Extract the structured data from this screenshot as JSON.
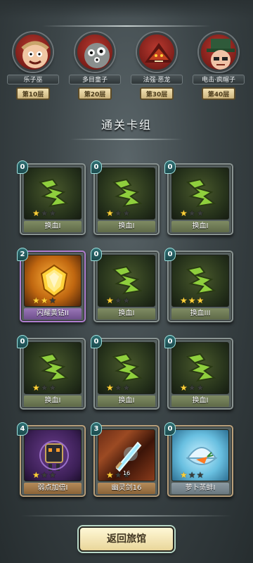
{
  "bosses": [
    {
      "name": "乐子巫",
      "floor": "第10层"
    },
    {
      "name": "多目童子",
      "floor": "第20层"
    },
    {
      "name": "法强·恶龙",
      "floor": "第30层"
    },
    {
      "name": "电击·疯帽子",
      "floor": "第40层"
    }
  ],
  "section_title": "通关卡组",
  "cards": [
    {
      "name": "换血I",
      "cost": "0",
      "stars": 1,
      "icon": "blood-swap-icon"
    },
    {
      "name": "换血I",
      "cost": "0",
      "stars": 1,
      "icon": "blood-swap-icon"
    },
    {
      "name": "换血I",
      "cost": "0",
      "stars": 1,
      "icon": "blood-swap-icon"
    },
    {
      "name": "闪耀黄钻II",
      "cost": "2",
      "stars": 2,
      "icon": "yellow-diamond-icon"
    },
    {
      "name": "换血I",
      "cost": "0",
      "stars": 1,
      "icon": "blood-swap-icon"
    },
    {
      "name": "换血III",
      "cost": "0",
      "stars": 3,
      "icon": "blood-swap-icon"
    },
    {
      "name": "换血I",
      "cost": "0",
      "stars": 1,
      "icon": "blood-swap-icon"
    },
    {
      "name": "换血I",
      "cost": "0",
      "stars": 1,
      "icon": "blood-swap-icon"
    },
    {
      "name": "换血I",
      "cost": "0",
      "stars": 1,
      "icon": "blood-swap-icon"
    },
    {
      "name": "弱点加倍I",
      "cost": "4",
      "stars": 1,
      "icon": "weakness-robot-icon"
    },
    {
      "name": "幽灵剑16",
      "cost": "3",
      "stars": 1,
      "badge": "16",
      "icon": "ghost-sword-icon"
    },
    {
      "name": "萝卜蒸蚌I",
      "cost": "0",
      "stars": 1,
      "icon": "carrot-clam-icon"
    }
  ],
  "buttons": {
    "return": "返回旅馆"
  },
  "colors": {
    "accent_gold": "#ffd23a",
    "panel": "#56605f"
  }
}
